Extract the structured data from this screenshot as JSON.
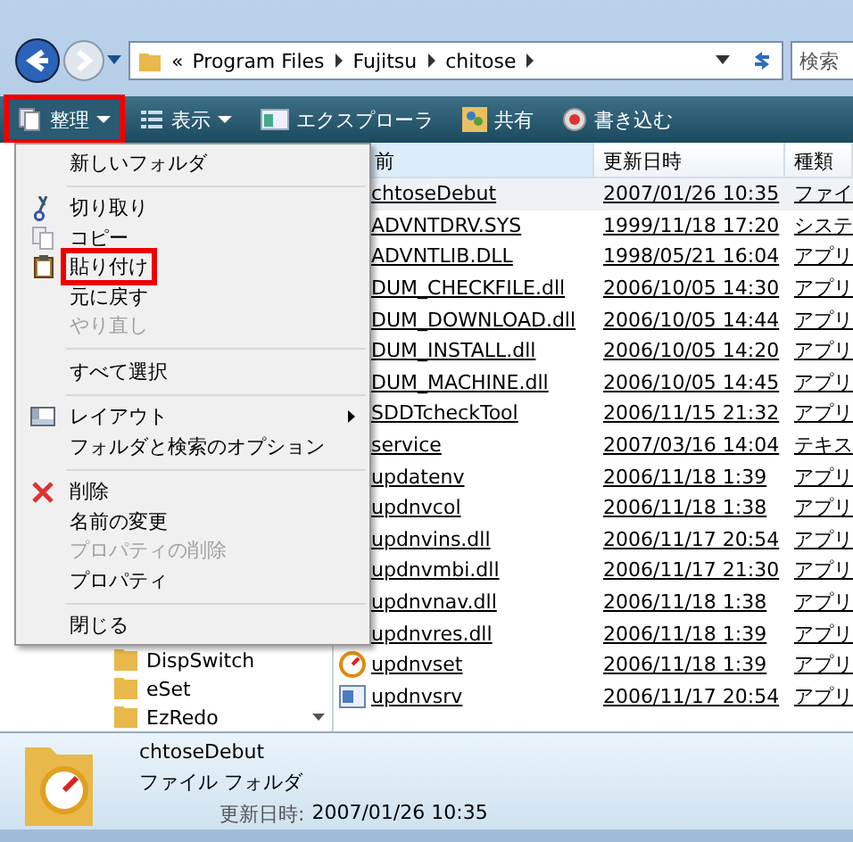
{
  "address_bar": {
    "crumbs": [
      "«",
      "Program Files",
      "Fujitsu",
      "chitose"
    ]
  },
  "search": {
    "placeholder": "検索"
  },
  "toolbar": [
    {
      "label": "整理",
      "kind": "organize",
      "dropdown": true,
      "highlighted": true
    },
    {
      "label": "表示",
      "kind": "views",
      "dropdown": true,
      "highlighted": false
    },
    {
      "label": "エクスプローラ",
      "kind": "explorer",
      "dropdown": false,
      "highlighted": false
    },
    {
      "label": "共有",
      "kind": "share",
      "dropdown": false,
      "highlighted": false
    },
    {
      "label": "書き込む",
      "kind": "burn",
      "dropdown": false,
      "highlighted": false
    }
  ],
  "menu": [
    {
      "kind": "plain",
      "label": "新しいフォルダ",
      "disabled": false,
      "highlighted": false,
      "submenu": false
    },
    {
      "kind": "separator"
    },
    {
      "kind": "cut",
      "label": "切り取り",
      "disabled": false,
      "highlighted": false,
      "submenu": false
    },
    {
      "kind": "copy",
      "label": "コピー",
      "disabled": false,
      "highlighted": false,
      "submenu": false
    },
    {
      "kind": "paste",
      "label": "貼り付け",
      "disabled": false,
      "highlighted": true,
      "submenu": false
    },
    {
      "kind": "plain",
      "label": "元に戻す",
      "disabled": false,
      "highlighted": false,
      "submenu": false
    },
    {
      "kind": "plain",
      "label": "やり直し",
      "disabled": true,
      "highlighted": false,
      "submenu": false
    },
    {
      "kind": "separator"
    },
    {
      "kind": "plain",
      "label": "すべて選択",
      "disabled": false,
      "highlighted": false,
      "submenu": false
    },
    {
      "kind": "separator"
    },
    {
      "kind": "layout",
      "label": "レイアウト",
      "disabled": false,
      "highlighted": false,
      "submenu": true
    },
    {
      "kind": "plain",
      "label": "フォルダと検索のオプション",
      "disabled": false,
      "highlighted": false,
      "submenu": false
    },
    {
      "kind": "separator"
    },
    {
      "kind": "delete",
      "label": "削除",
      "disabled": false,
      "highlighted": false,
      "submenu": false
    },
    {
      "kind": "plain",
      "label": "名前の変更",
      "disabled": false,
      "highlighted": false,
      "submenu": false
    },
    {
      "kind": "plain",
      "label": "プロパティの削除",
      "disabled": true,
      "highlighted": false,
      "submenu": false
    },
    {
      "kind": "plain",
      "label": "プロパティ",
      "disabled": false,
      "highlighted": false,
      "submenu": false
    },
    {
      "kind": "separator"
    },
    {
      "kind": "plain",
      "label": "閉じる",
      "disabled": false,
      "highlighted": false,
      "submenu": false
    }
  ],
  "nav_pane": {
    "items": [
      "DispSwitch",
      "eSet",
      "EzRedo"
    ]
  },
  "columns": [
    "前",
    "更新日時",
    "種類"
  ],
  "rows": [
    {
      "name": "chtoseDebut",
      "date": "2007/01/26 10:35",
      "type": "ファイ",
      "kind": "hidden",
      "selected": true
    },
    {
      "name": "ADVNTDRV.SYS",
      "date": "1999/11/18 17:20",
      "type": "システ",
      "kind": "hidden",
      "selected": false
    },
    {
      "name": "ADVNTLIB.DLL",
      "date": "1998/05/21 16:04",
      "type": "アプリ",
      "kind": "hidden",
      "selected": false
    },
    {
      "name": "DUM_CHECKFILE.dll",
      "date": "2006/10/05 14:30",
      "type": "アプリ",
      "kind": "hidden",
      "selected": false
    },
    {
      "name": "DUM_DOWNLOAD.dll",
      "date": "2006/10/05 14:44",
      "type": "アプリ",
      "kind": "hidden",
      "selected": false
    },
    {
      "name": "DUM_INSTALL.dll",
      "date": "2006/10/05 14:20",
      "type": "アプリ",
      "kind": "hidden",
      "selected": false
    },
    {
      "name": "DUM_MACHINE.dll",
      "date": "2006/10/05 14:45",
      "type": "アプリ",
      "kind": "hidden",
      "selected": false
    },
    {
      "name": "SDDTcheckTool",
      "date": "2006/11/15 21:32",
      "type": "アプリ",
      "kind": "hidden",
      "selected": false
    },
    {
      "name": "service",
      "date": "2007/03/16 14:04",
      "type": "テキス",
      "kind": "hidden",
      "selected": false
    },
    {
      "name": "updatenv",
      "date": "2006/11/18 1:39",
      "type": "アプリ",
      "kind": "hidden",
      "selected": false
    },
    {
      "name": "updnvcol",
      "date": "2006/11/18 1:38",
      "type": "アプリ",
      "kind": "hidden",
      "selected": false
    },
    {
      "name": "updnvins.dll",
      "date": "2006/11/17 20:54",
      "type": "アプリ",
      "kind": "hidden",
      "selected": false
    },
    {
      "name": "updnvmbi.dll",
      "date": "2006/11/17 21:30",
      "type": "アプリ",
      "kind": "hidden",
      "selected": false
    },
    {
      "name": "updnvnav.dll",
      "date": "2006/11/18 1:38",
      "type": "アプリ",
      "kind": "hidden",
      "selected": false
    },
    {
      "name": "updnvres.dll",
      "date": "2006/11/18 1:39",
      "type": "アプリ",
      "kind": "hidden",
      "selected": false
    },
    {
      "name": "updnvset",
      "date": "2006/11/18 1:39",
      "type": "アプリ",
      "kind": "setup",
      "selected": false
    },
    {
      "name": "updnvsrv",
      "date": "2006/11/17 20:54",
      "type": "アプリ",
      "kind": "service",
      "selected": false
    }
  ],
  "details": {
    "name": "chtoseDebut",
    "type": "ファイル フォルダ",
    "modified_label": "更新日時:",
    "modified": "2007/01/26 10:35"
  }
}
